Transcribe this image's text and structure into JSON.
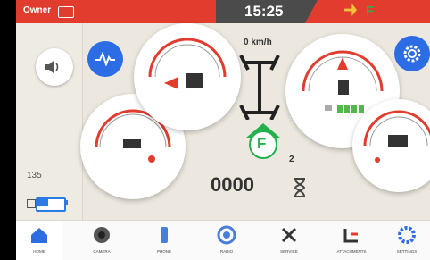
{
  "status": {
    "owner": "Owner",
    "time": "15:25",
    "gear": "F"
  },
  "left": {
    "odometer_small": "135"
  },
  "center": {
    "speed": "0 km/h",
    "gear": "F",
    "count": "2",
    "hours": "0000"
  },
  "nav": [
    {
      "label": "HOME",
      "icon": "home-icon"
    },
    {
      "label": "CAMERA",
      "icon": "camera-icon"
    },
    {
      "label": "PHONE",
      "icon": "phone-icon"
    },
    {
      "label": "RADIO",
      "icon": "radio-icon"
    },
    {
      "label": "SERVICE",
      "icon": "service-icon"
    },
    {
      "label": "ATTACHMENTS",
      "icon": "attachments-icon"
    },
    {
      "label": "SETTINGS",
      "icon": "settings-icon"
    }
  ],
  "colors": {
    "accent": "#2c6de5",
    "status_red": "#e23c2e",
    "green": "#22b14c",
    "warning": "#f3c23b"
  }
}
